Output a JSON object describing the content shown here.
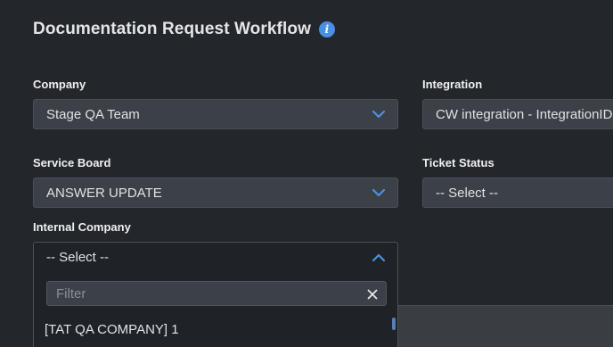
{
  "header": {
    "title": "Documentation Request Workflow",
    "info_icon": "info-icon"
  },
  "fields": {
    "company": {
      "label": "Company",
      "value": "Stage QA Team"
    },
    "integration": {
      "label": "Integration",
      "value": "CW integration - IntegrationID"
    },
    "service_board": {
      "label": "Service Board",
      "value": "ANSWER UPDATE"
    },
    "ticket_status": {
      "label": "Ticket Status",
      "value": "-- Select --"
    },
    "internal_company": {
      "label": "Internal Company",
      "value": "-- Select --",
      "filter_placeholder": "Filter",
      "options": [
        "[TAT QA COMPANY] 1"
      ]
    }
  },
  "colors": {
    "background": "#23262b",
    "field": "#3c4047",
    "accent": "#4a90e2"
  }
}
